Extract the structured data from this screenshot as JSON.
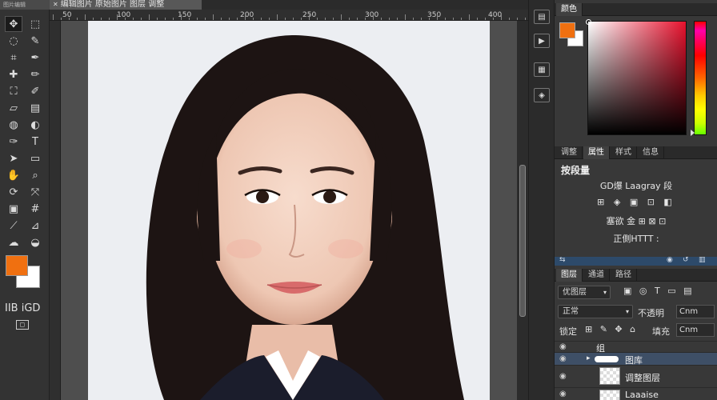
{
  "app": {
    "menu_text": "图片编辑",
    "doc_tab_title": "编辑图片 原始图片 图层 调整"
  },
  "ruler": {
    "ticks": [
      "50",
      "100",
      "150",
      "200",
      "250",
      "300",
      "350",
      "400",
      "450"
    ]
  },
  "colors": {
    "foreground": "#f07010",
    "background": "#ffffff",
    "accent_blue": "#3e4f66"
  },
  "toolbar": {
    "tools": [
      {
        "icon": "move-icon",
        "glyph": "✥"
      },
      {
        "icon": "marquee-icon",
        "glyph": "⬚"
      },
      {
        "icon": "lasso-icon",
        "glyph": "◌"
      },
      {
        "icon": "quick-select-icon",
        "glyph": "✎"
      },
      {
        "icon": "crop-icon",
        "glyph": "⌗"
      },
      {
        "icon": "eyedropper-icon",
        "glyph": "✒"
      },
      {
        "icon": "healing-icon",
        "glyph": "✚"
      },
      {
        "icon": "brush-icon",
        "glyph": "✏"
      },
      {
        "icon": "stamp-icon",
        "glyph": "⛶"
      },
      {
        "icon": "history-brush-icon",
        "glyph": "✐"
      },
      {
        "icon": "eraser-icon",
        "glyph": "▱"
      },
      {
        "icon": "gradient-icon",
        "glyph": "▤"
      },
      {
        "icon": "blur-icon",
        "glyph": "◍"
      },
      {
        "icon": "dodge-icon",
        "glyph": "◐"
      },
      {
        "icon": "pen-icon",
        "glyph": "✑"
      },
      {
        "icon": "type-icon",
        "glyph": "T"
      },
      {
        "icon": "path-select-icon",
        "glyph": "➤"
      },
      {
        "icon": "shape-icon",
        "glyph": "▭"
      },
      {
        "icon": "hand-icon",
        "glyph": "✋"
      },
      {
        "icon": "zoom-icon",
        "glyph": "⌕"
      },
      {
        "icon": "3d-rotate-icon",
        "glyph": "⟳"
      },
      {
        "icon": "3d-pan-icon",
        "glyph": "⤧"
      },
      {
        "icon": "note-icon",
        "glyph": "▣"
      },
      {
        "icon": "count-icon",
        "glyph": "#"
      },
      {
        "icon": "slice-icon",
        "glyph": "⟋"
      },
      {
        "icon": "ruler-icon",
        "glyph": "⊿"
      },
      {
        "icon": "smudge-icon",
        "glyph": "☁"
      },
      {
        "icon": "sponge-icon",
        "glyph": "◒"
      }
    ],
    "label": "IIB iGD",
    "mask_glyph": "◻"
  },
  "dock": {
    "icons": [
      "history-icon",
      "actions-icon",
      "swatches-icon",
      "styles-icon",
      "brushes-icon",
      "clone-source-icon"
    ]
  },
  "color_panel": {
    "title": "颜色"
  },
  "properties_panel": {
    "tabs": [
      "调整",
      "属性",
      "样式",
      "信息"
    ],
    "title": "按段量",
    "line1": "GD爆 Laagray 段",
    "line2": "⊞ ◈ ▣ ⊡ ◧",
    "line3": "塞欲 金 ⊞ ⊠ ⊡",
    "line4": "正側HTTT :"
  },
  "layers_panel": {
    "tabs": [
      "图层",
      "通道",
      "路径"
    ],
    "filter_label": "优图层",
    "blend_mode": "正常",
    "opacity_label": "不透明",
    "opacity_value": "Cnm",
    "lock_label": "锁定",
    "fill_label": "填充",
    "fill_value": "Cnm",
    "layers": [
      {
        "name": "组",
        "type": "group"
      },
      {
        "name": "图库",
        "type": "group-selected"
      },
      {
        "name": "调整图层",
        "type": "layer"
      },
      {
        "name": "Laaaise",
        "type": "layer"
      }
    ]
  }
}
